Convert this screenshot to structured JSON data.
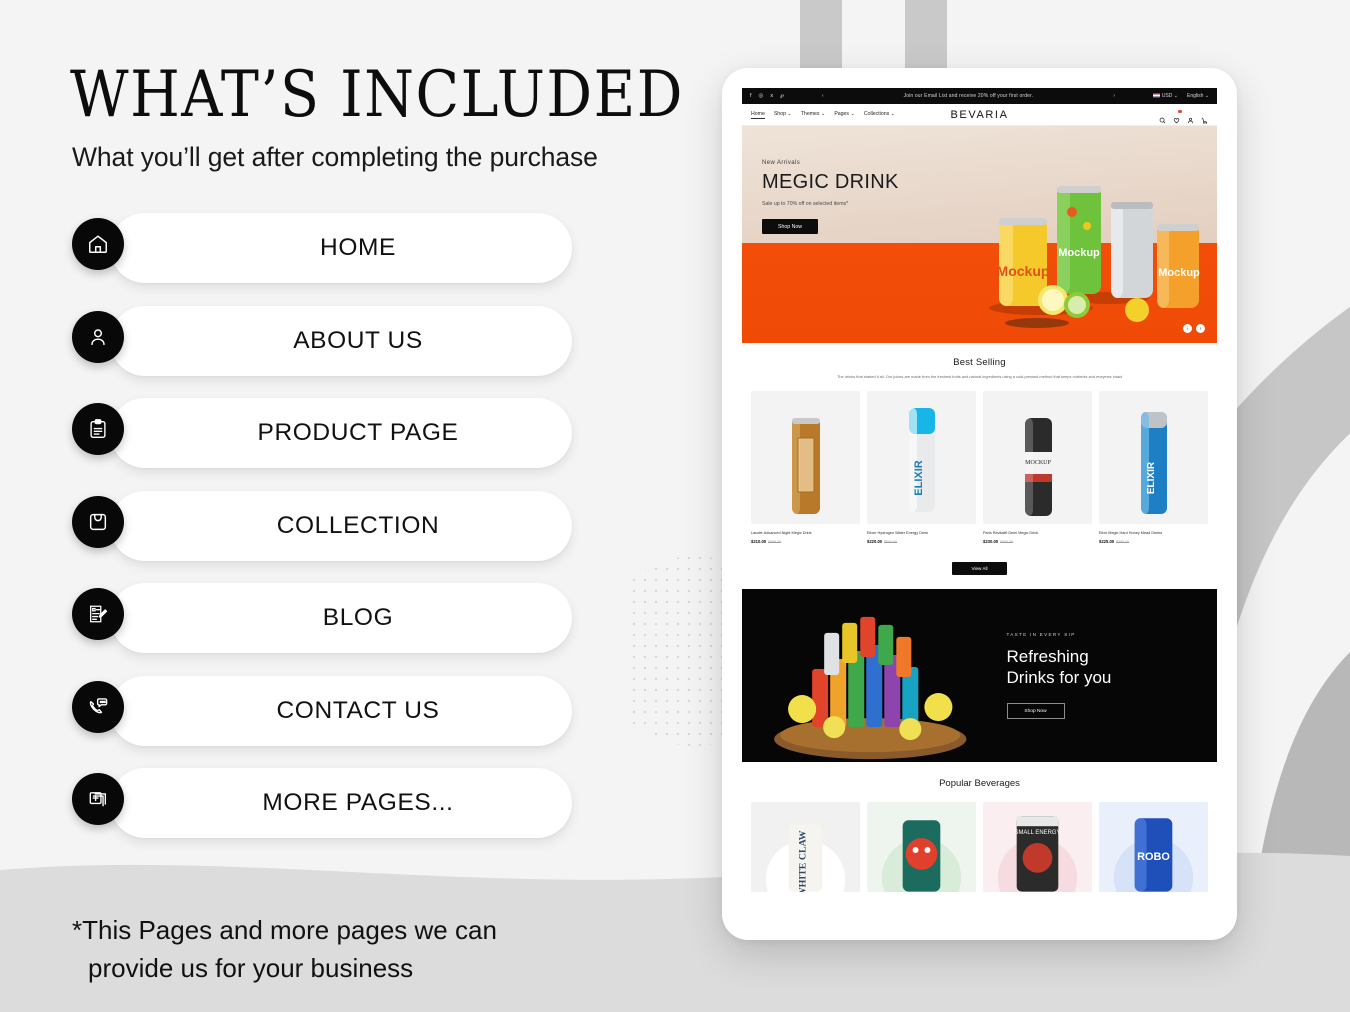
{
  "page": {
    "title": "WHAT’S INCLUDED",
    "subtitle": "What you’ll get after completing the purchase",
    "footnote_line1": "*This Pages and more pages we can",
    "footnote_line2": "provide us for your business",
    "accent_dark": "#0a0a0a",
    "accent_orange": "#f24e0a",
    "background": "#f4f4f4"
  },
  "pages_list": [
    {
      "label": "HOME",
      "icon": "home-icon"
    },
    {
      "label": "ABOUT US",
      "icon": "user-icon"
    },
    {
      "label": "PRODUCT PAGE",
      "icon": "clipboard-icon"
    },
    {
      "label": "COLLECTION",
      "icon": "shopping-bag-icon"
    },
    {
      "label": "BLOG",
      "icon": "document-pencil-icon"
    },
    {
      "label": "CONTACT US",
      "icon": "phone-chat-icon"
    },
    {
      "label": "MORE PAGES...",
      "icon": "add-pages-icon"
    }
  ],
  "site": {
    "announcement": {
      "social": [
        "facebook-icon",
        "instagram-icon",
        "x-icon",
        "pinterest-icon"
      ],
      "prev": "‹",
      "message": "Join our Email List and receive 20% off your first order.",
      "next": "›",
      "currency": "USD",
      "language": "English"
    },
    "nav": {
      "links": [
        "Home",
        "Shop",
        "Themes",
        "Pages",
        "Collections"
      ],
      "brand": "BEVARIA",
      "icons": [
        "search-icon",
        "wishlist-heart-icon",
        "account-icon",
        "cart-icon"
      ]
    },
    "hero": {
      "eyebrow": "New Arrivals",
      "title": "MEGIC DRINK",
      "subtitle": "Sale up to 70% off on selected items*",
      "button": "Shop Now",
      "prev_arrow": "‹",
      "next_arrow": "›"
    },
    "best_selling": {
      "title": "Best Selling",
      "description": "The drinks that started it all. Our juices are made from the freshest fruits and natural ingredients using a cold-pressed method that keeps nutrients and enzymes intact",
      "products": [
        {
          "name": "Lauder Advanced Night Megic Drink",
          "price": "$210.00",
          "compare": "$399.00"
        },
        {
          "name": "Elixer Hydrogen Water Energy Drink",
          "price": "$220.00",
          "compare": "$500.00"
        },
        {
          "name": "Paris Revitalift Demi Megic Drink",
          "price": "$230.00",
          "compare": "$300.00"
        },
        {
          "name": "Elixir Megic Hard Honey Mead Drinks",
          "price": "$225.00",
          "compare": "$395.00"
        }
      ],
      "view_all": "View All"
    },
    "promo": {
      "eyebrow": "TASTE IN EVERY SIP",
      "title_line1": "Refreshing",
      "title_line2": "Drinks for you",
      "button": "Shop Now"
    },
    "popular": {
      "title": "Popular Beverages",
      "items": [
        "WHITE CLAW",
        "Octopus Can",
        "SMALL ENERGY",
        "ROBO"
      ]
    }
  }
}
